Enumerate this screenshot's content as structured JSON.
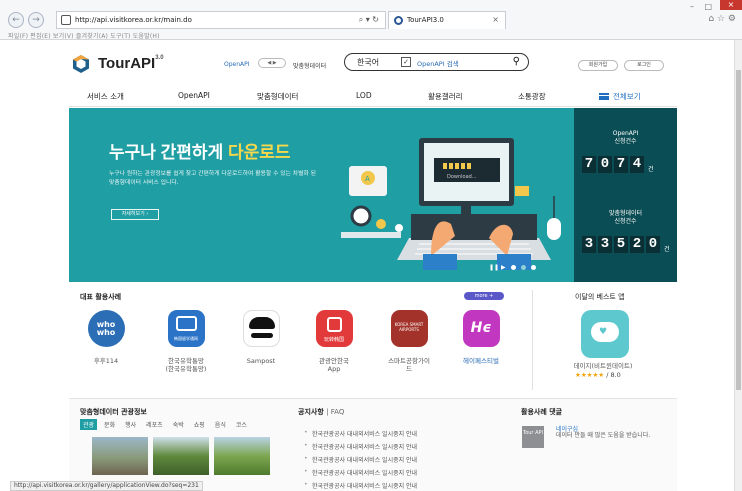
{
  "browser": {
    "address": "http://api.visitkorea.or.kr/main.do",
    "address_icons": "⌕ ▾ ↻",
    "tab_label": "TourAPI3.0",
    "menu": "파일(F)   편집(E)   보기(V)   즐겨찾기(A)   도구(T)   도움말(H)",
    "status_url": "http://api.visitkorea.or.kr/gallery/applicationView.do?seq=231"
  },
  "header": {
    "logo": "TourAPI",
    "logo_version": "3.0",
    "openapi": "OpenAPI",
    "toggle": "◀ ▶",
    "matchum": "맞춤형데이터",
    "search_lang": "한국어",
    "search_check": "✓",
    "search_placeholder": "OpenAPI 검색",
    "signup": "회원가입",
    "login": "로그인"
  },
  "nav": {
    "items": [
      "서비스 소개",
      "OpenAPI",
      "맞춤형데이터",
      "LOD",
      "활용갤러리",
      "소통광장"
    ],
    "all_view": "전체보기"
  },
  "hero": {
    "title_pre": "누구나 간편하게 ",
    "title_highlight": "다운로드",
    "desc": "누구나 원하는 관광정보를 쉽게 찾고 간편하게 다운로드하여 활용할 수 있는 차별화 된 맞춤형데이터 서비스 입니다.",
    "button": "자세히보기 ›",
    "download_label": "Download...",
    "stat1_label": "OpenAPI\n신청건수",
    "stat1_digits": [
      "7",
      "0",
      "7",
      "4"
    ],
    "stat2_label": "맞춤형데이터\n신청건수",
    "stat2_digits": [
      "3",
      "3",
      "5",
      "2",
      "0"
    ],
    "unit": "건",
    "pager": "❚❚ ▶"
  },
  "cases": {
    "title": "대표 활용사례",
    "more": "more +",
    "apps": [
      {
        "label": "후후114",
        "icon": "whowho-app-icon",
        "icon_text": "who who"
      },
      {
        "label": "한국유학통망\n(한국유학통망)",
        "icon": "study-korea-app-icon",
        "icon_text": "韩国留学通网"
      },
      {
        "label": "Sampost",
        "icon": "sampost-app-icon",
        "icon_text": ""
      },
      {
        "label": "관광안한국\nApp",
        "icon": "tourism-korea-app-icon",
        "icon_text": "玩转韩国"
      },
      {
        "label": "스마트공항가이\n드",
        "icon": "smart-airports-app-icon",
        "icon_text": "KOREA SMART AIRPORTS"
      },
      {
        "label": "헤이페스티벌",
        "icon": "hey-festival-app-icon",
        "icon_text": "Hϵ"
      }
    ]
  },
  "best_app": {
    "title": "이달의 베스트 앱",
    "name": "데이지(비트윈데이트)",
    "stars": "★★★★★",
    "score": "/ 8.0"
  },
  "tour_info": {
    "title": "맞춤형데이터 관광정보",
    "tags": [
      "관광",
      "문화",
      "행사",
      "레포츠",
      "숙박",
      "쇼핑",
      "음식",
      "코스"
    ]
  },
  "notice": {
    "title": "공지사항",
    "faq": "| FAQ",
    "items": [
      "한국관광공사 대내외서비스 일시중지 안내",
      "한국관광공사 대내외서비스 일시중지 안내",
      "한국관광공사 대내외서비스 일시중지 안내",
      "한국관광공사 대내외서비스 일시중지 안내",
      "한국관광공사 대내외서비스 일시중지 안내"
    ]
  },
  "comments": {
    "title": "활용사례 댓글",
    "avatar": "Tour API",
    "user": "네이구심",
    "text": "데이터 만들 때 많은 도움을 받습니다."
  },
  "colors": {
    "hero_bg": "#1f9ea4",
    "stats_bg": "#0b4d54",
    "highlight": "#f5d84c",
    "brand_blue": "#1f6fc0"
  }
}
